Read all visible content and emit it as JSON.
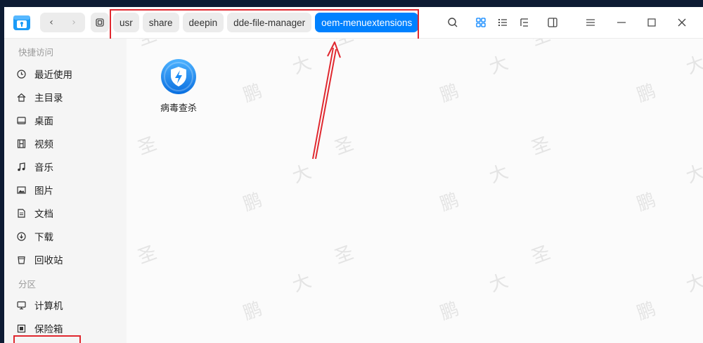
{
  "titlebar": {
    "breadcrumbs": [
      "usr",
      "share",
      "deepin",
      "dde-file-manager",
      "oem-menuextensions"
    ],
    "active_crumb": 4
  },
  "sidebar": {
    "quick_access_title": "快捷访问",
    "quick_access_items": [
      {
        "label": "最近使用",
        "icon": "clock-icon"
      },
      {
        "label": "主目录",
        "icon": "home-icon"
      },
      {
        "label": "桌面",
        "icon": "desktop-icon"
      },
      {
        "label": "视频",
        "icon": "video-icon"
      },
      {
        "label": "音乐",
        "icon": "music-icon"
      },
      {
        "label": "图片",
        "icon": "picture-icon"
      },
      {
        "label": "文档",
        "icon": "document-icon"
      },
      {
        "label": "下载",
        "icon": "download-icon"
      },
      {
        "label": "回收站",
        "icon": "trash-icon"
      }
    ],
    "partition_title": "分区",
    "partition_items": [
      {
        "label": "计算机",
        "icon": "computer-icon"
      },
      {
        "label": "保险箱",
        "icon": "safe-icon"
      }
    ]
  },
  "content": {
    "files": [
      {
        "name": "病毒查杀",
        "icon": "antivirus-shield-icon"
      }
    ],
    "watermark_chars": [
      "大",
      "圣",
      "鹏"
    ]
  },
  "colors": {
    "accent": "#0081ff",
    "annotation": "#e0282f"
  }
}
